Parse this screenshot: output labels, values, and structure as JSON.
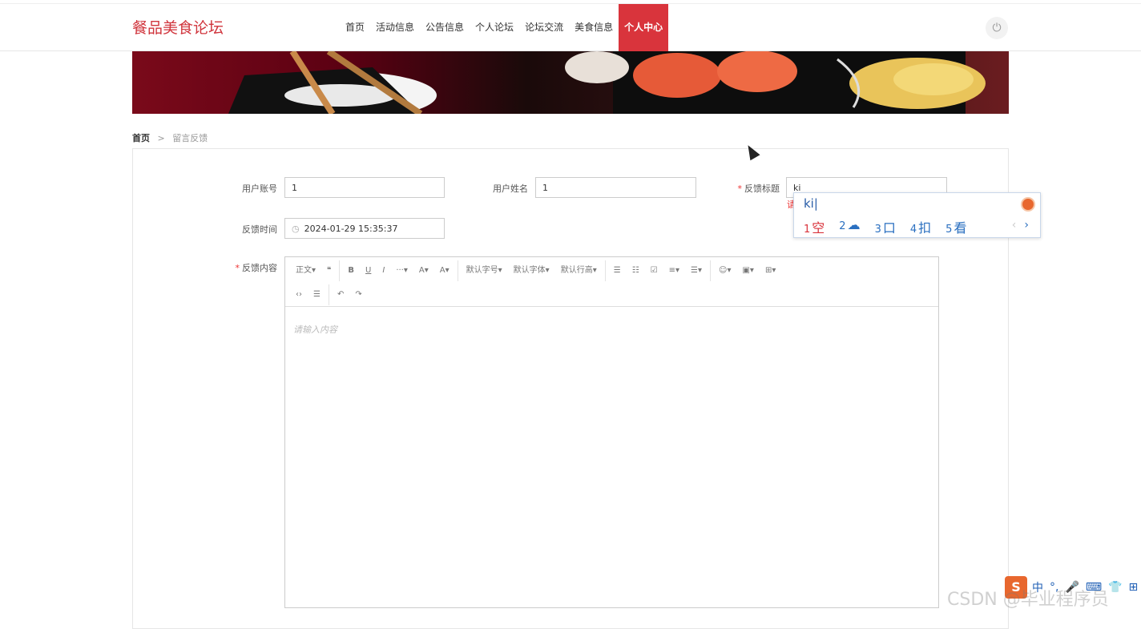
{
  "brand": "餐品美食论坛",
  "nav": [
    "首页",
    "活动信息",
    "公告信息",
    "个人论坛",
    "论坛交流",
    "美食信息",
    "个人中心"
  ],
  "nav_active": "个人中心",
  "power_icon": "⏻",
  "breadcrumb": {
    "home": "首页",
    "separator": ">",
    "current": "留言反馈"
  },
  "form": {
    "account_label": "用户账号",
    "account_value": "1",
    "name_label": "用户姓名",
    "name_value": "1",
    "title_label": "反馈标题",
    "title_value": "ki",
    "time_label": "反馈时间",
    "time_value": "2024-01-29 15:35:37",
    "content_label": "反馈内容",
    "content_placeholder": "请输入内容",
    "error_hint": "请"
  },
  "editor_toolbar": {
    "row1": [
      "正文▾",
      "❝",
      "B",
      "U",
      "I",
      "···▾",
      "A▾",
      "A▾",
      "默认字号▾",
      "默认字体▾",
      "默认行高▾",
      "☰",
      "☷",
      "☑",
      "≡▾",
      "☰▾",
      "☺▾",
      "▣▾",
      "⊞▾"
    ],
    "row2": [
      "‹›",
      "☰",
      "↶",
      "↷"
    ]
  },
  "ime": {
    "composition": "ki",
    "candidates": [
      {
        "n": "1",
        "text": "空"
      },
      {
        "n": "2",
        "text": "☁"
      },
      {
        "n": "3",
        "text": "口"
      },
      {
        "n": "4",
        "text": "扣"
      },
      {
        "n": "5",
        "text": "看"
      }
    ]
  },
  "tray": {
    "logo": "S",
    "items": [
      "中",
      "°,",
      "🎤",
      "⌨",
      "👕",
      "⊞"
    ]
  },
  "watermark": "CSDN @毕业程序员"
}
